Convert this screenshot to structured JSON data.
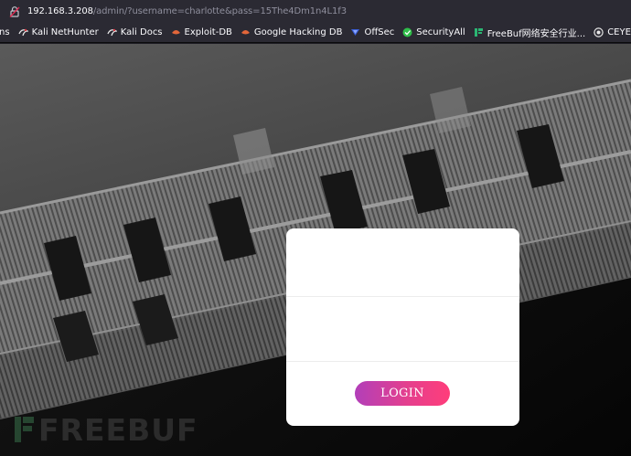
{
  "address_bar": {
    "host": "192.168.3.208",
    "path": "/admin/?username=charlotte&pass=15The4Dm1n4L1f3"
  },
  "bookmarks": [
    {
      "label": "ns",
      "icon": "bookmark-icon"
    },
    {
      "label": "Kali NetHunter",
      "icon": "kali-icon"
    },
    {
      "label": "Kali Docs",
      "icon": "kali-icon"
    },
    {
      "label": "Exploit-DB",
      "icon": "exploit-db-icon"
    },
    {
      "label": "Google Hacking DB",
      "icon": "ghdb-icon"
    },
    {
      "label": "OffSec",
      "icon": "offsec-icon"
    },
    {
      "label": "SecurityAll",
      "icon": "securityall-icon"
    },
    {
      "label": "FreeBuf网络安全行业...",
      "icon": "freebuf-icon"
    },
    {
      "label": "CEYE - Monitor servic...",
      "icon": "ceye-icon"
    }
  ],
  "login_form": {
    "username_value": "",
    "password_value": "",
    "button_label": "LOGIN"
  },
  "watermark": {
    "text": "FREEBUF"
  },
  "colors": {
    "toolbar": "#2b2a33",
    "button_gradient_start": "#b23fb9",
    "button_gradient_end": "#ff3d7a",
    "card": "#ffffff"
  }
}
